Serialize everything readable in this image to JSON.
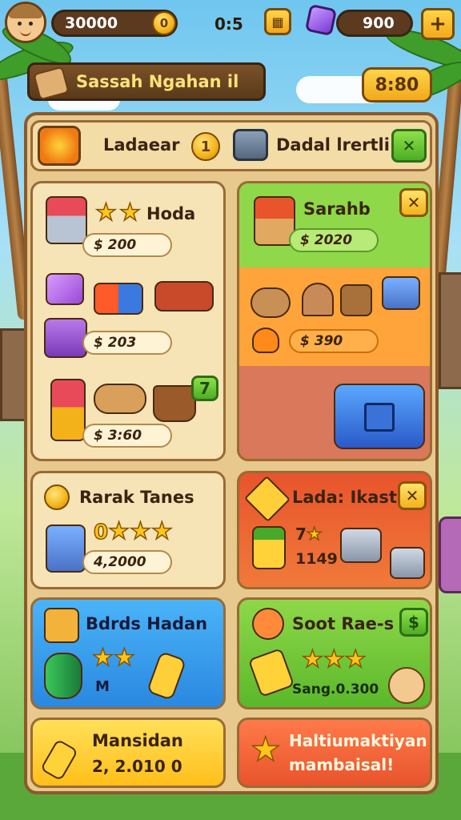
{
  "top_bar": {
    "coins": "30000",
    "coin_icon_glyph": "0",
    "timer": "0:5",
    "gems": "900",
    "add_glyph": "+"
  },
  "banner": {
    "title": "Sassah Ngahan il",
    "badge": "8:80"
  },
  "header_row": {
    "left_label": "Ladaear",
    "left_count": "1",
    "right_label": "Dadal lrertli",
    "action_glyph": "✕"
  },
  "cards": {
    "hoda": {
      "title": "Hoda",
      "price1": "$ 200",
      "price2": "$ 203",
      "price3": "$ 3:60",
      "level": "7"
    },
    "sarahb": {
      "title": "Sarahb",
      "price1": "$ 2020",
      "price2": "$ 390"
    },
    "rarak": {
      "title": "Rarak Tanes",
      "rating_text": "0",
      "price": "4,2000"
    },
    "ladaikast": {
      "title": "Lada: Ikast",
      "count": "7",
      "value": "1149"
    },
    "bdrds": {
      "title": "Bdrds Hadan",
      "code": "M"
    },
    "soot": {
      "title": "Soot Rae-s",
      "price": "Sang.0.300",
      "button_glyph": "$"
    },
    "mansidan": {
      "title": "Mansidan",
      "value": "2, 2.010 0"
    },
    "haltiu": {
      "title": "Haltiumaktiyan",
      "subtitle": "mambaisal!"
    }
  },
  "colors": {
    "wood": "#8a5a2b",
    "parchment": "#f6e4b6",
    "green": "#7ed13c",
    "orange": "#ff9a2a",
    "red": "#e8542c",
    "blue": "#35a3ee",
    "yellow": "#ffd23a"
  }
}
